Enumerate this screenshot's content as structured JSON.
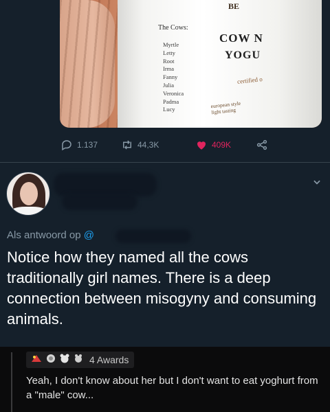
{
  "photo": {
    "brand_top": "BE",
    "cows_title": "The Cows:",
    "cow_names": [
      "Myrtle",
      "Letty",
      "Root",
      "Irma",
      "Fanny",
      "Julia",
      "Veronica",
      "Padma",
      "Lucy"
    ],
    "brand_line1": "COW N",
    "brand_line2": "YOGU",
    "certified": "certified o",
    "tagline_line1": "european style",
    "tagline_line2": "light tasting"
  },
  "tweet_actions": {
    "replies": "1.137",
    "retweets": "44,3K",
    "likes": "409K",
    "like_color": "#e0245e"
  },
  "reply": {
    "reply_to_prefix": "Als antwoord op",
    "reply_to_handle": "@",
    "text": "Notice how they named all the cows traditionally girl names. There is a deep connection between misogyny and consuming animals."
  },
  "comment": {
    "awards_label": "4 Awards",
    "text": "Yeah, I don't know about her but I don't want to eat yoghurt from a \"male\" cow..."
  },
  "colors": {
    "twitter_bg": "#15202b",
    "muted_text": "#8899a6",
    "accent_blue": "#1da1f2",
    "reddit_bg": "#0b0b0c"
  },
  "icons": [
    "reply-icon",
    "retweet-icon",
    "heart-icon",
    "share-icon",
    "chevron-down-icon",
    "award-icon"
  ]
}
